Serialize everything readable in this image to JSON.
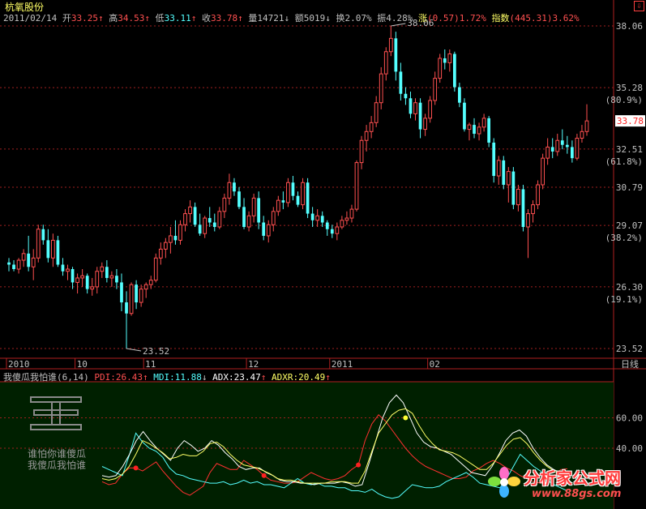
{
  "stock": {
    "name": "杭氧股份",
    "corner_icon": "close-box-icon"
  },
  "quote": {
    "date": "2011/02/14",
    "open_label": "开",
    "open": "33.25",
    "high_label": "高",
    "high": "34.53",
    "low_label": "低",
    "low": "33.11",
    "close_label": "收",
    "close": "33.78",
    "vol_label": "量",
    "vol": "14721",
    "amt_label": "额",
    "amt": "5019",
    "turn_label": "换",
    "turn": "2.07%",
    "amp_label": "振",
    "amp": "4.28%",
    "chg_label": "涨",
    "chg": "(0.57)",
    "chg_pct": "1.72%",
    "idx_label": "指数",
    "idx": "(445.31)",
    "idx_pct": "3.62%"
  },
  "price_axis": [
    {
      "v": 38.06,
      "label": "38.06",
      "pct": ""
    },
    {
      "v": 35.28,
      "label": "35.28",
      "pct": "(80.9%)"
    },
    {
      "v": 32.51,
      "label": "32.51",
      "pct": "(61.8%)"
    },
    {
      "v": 30.79,
      "label": "30.79",
      "pct": ""
    },
    {
      "v": 29.07,
      "label": "29.07",
      "pct": "(38.2%)"
    },
    {
      "v": 26.3,
      "label": "26.30",
      "pct": "(19.1%)"
    },
    {
      "v": 23.52,
      "label": "23.52",
      "pct": ""
    }
  ],
  "last_price_tag": "33.78",
  "max_label": "38.06",
  "min_label": "23.52",
  "time_axis": [
    "2010",
    "10",
    "11",
    "12",
    "2011",
    "02"
  ],
  "period_label": "日线",
  "indicator": {
    "name": "我傻瓜我怕谁(6,14)",
    "pdi_label": "PDI:",
    "pdi": "26.43",
    "mdi_label": "MDI:",
    "mdi": "11.88",
    "adx_label": "ADX:",
    "adx": "23.47",
    "adxr_label": "ADXR:",
    "adxr": "20.49",
    "levels": [
      "60.00",
      "40.00"
    ],
    "watermark_line1": "谁怕你谁傻瓜",
    "watermark_line2": "我傻瓜我怕谁"
  },
  "logo": {
    "text": "分析家公式网",
    "url": "www.88gs.com"
  },
  "colors": {
    "up": "#ff5050",
    "down": "#54ffff",
    "pdi": "#ff3030",
    "mdi": "#54ffff",
    "adx": "#ffffff",
    "adxr": "#ffff66",
    "panel_bg": "#002000"
  },
  "chart_data": [
    {
      "type": "candlestick",
      "title": "杭氧股份",
      "ylim": [
        23.52,
        38.06
      ],
      "candles": [
        [
          27.4,
          27.6,
          27.0,
          27.3
        ],
        [
          27.3,
          27.5,
          27.0,
          27.1
        ],
        [
          27.1,
          27.6,
          26.9,
          27.5
        ],
        [
          27.5,
          28.0,
          27.2,
          27.8
        ],
        [
          27.8,
          28.6,
          27.0,
          27.2
        ],
        [
          27.2,
          28.0,
          26.6,
          27.6
        ],
        [
          27.6,
          29.1,
          27.4,
          28.9
        ],
        [
          28.9,
          29.1,
          28.2,
          28.4
        ],
        [
          28.4,
          28.9,
          27.4,
          27.6
        ],
        [
          27.6,
          28.7,
          27.2,
          28.4
        ],
        [
          28.4,
          28.6,
          27.2,
          27.3
        ],
        [
          27.3,
          27.6,
          26.8,
          27.0
        ],
        [
          27.0,
          27.3,
          26.6,
          27.1
        ],
        [
          27.1,
          27.2,
          26.2,
          26.5
        ],
        [
          26.5,
          26.9,
          26.0,
          26.7
        ],
        [
          26.7,
          27.1,
          26.3,
          26.8
        ],
        [
          26.8,
          26.9,
          26.0,
          26.2
        ],
        [
          26.2,
          26.7,
          25.9,
          26.3
        ],
        [
          26.3,
          27.2,
          26.0,
          27.0
        ],
        [
          27.0,
          27.4,
          26.7,
          27.2
        ],
        [
          27.2,
          27.5,
          26.5,
          26.7
        ],
        [
          26.7,
          27.0,
          26.3,
          26.8
        ],
        [
          26.8,
          27.1,
          26.2,
          26.5
        ],
        [
          26.5,
          26.9,
          25.2,
          25.6
        ],
        [
          25.6,
          26.1,
          23.52,
          25.1
        ],
        [
          25.1,
          26.5,
          25.0,
          26.4
        ],
        [
          26.4,
          26.6,
          25.3,
          25.6
        ],
        [
          25.6,
          26.4,
          25.4,
          26.2
        ],
        [
          26.2,
          26.5,
          25.8,
          26.4
        ],
        [
          26.4,
          26.8,
          26.2,
          26.6
        ],
        [
          26.6,
          27.8,
          26.5,
          27.6
        ],
        [
          27.6,
          28.3,
          27.3,
          28.0
        ],
        [
          28.0,
          28.5,
          27.6,
          28.3
        ],
        [
          28.3,
          29.0,
          27.8,
          28.6
        ],
        [
          28.6,
          29.3,
          28.2,
          28.4
        ],
        [
          28.4,
          29.3,
          28.2,
          29.1
        ],
        [
          29.1,
          29.8,
          28.8,
          29.6
        ],
        [
          29.6,
          30.2,
          29.2,
          29.9
        ],
        [
          29.9,
          30.1,
          29.0,
          29.1
        ],
        [
          29.1,
          29.6,
          28.6,
          28.7
        ],
        [
          28.7,
          29.5,
          28.5,
          29.4
        ],
        [
          29.4,
          29.9,
          29.0,
          29.2
        ],
        [
          29.2,
          29.6,
          28.8,
          29.0
        ],
        [
          29.0,
          29.9,
          28.9,
          29.7
        ],
        [
          29.7,
          30.5,
          29.4,
          30.3
        ],
        [
          30.3,
          31.4,
          30.0,
          31.0
        ],
        [
          31.0,
          31.2,
          30.4,
          30.6
        ],
        [
          30.6,
          30.8,
          29.8,
          29.9
        ],
        [
          29.9,
          30.3,
          28.9,
          29.0
        ],
        [
          29.0,
          29.7,
          28.8,
          29.5
        ],
        [
          29.5,
          30.5,
          29.2,
          30.3
        ],
        [
          30.3,
          30.6,
          28.9,
          29.2
        ],
        [
          29.2,
          29.5,
          28.4,
          28.6
        ],
        [
          28.6,
          29.3,
          28.3,
          29.1
        ],
        [
          29.1,
          29.9,
          28.8,
          29.7
        ],
        [
          29.7,
          30.4,
          29.5,
          30.2
        ],
        [
          30.2,
          30.6,
          29.8,
          30.1
        ],
        [
          30.1,
          31.2,
          29.9,
          31.0
        ],
        [
          31.0,
          31.3,
          30.2,
          30.4
        ],
        [
          30.4,
          30.6,
          29.9,
          30.0
        ],
        [
          30.0,
          31.2,
          29.8,
          31.0
        ],
        [
          31.0,
          31.2,
          29.4,
          29.6
        ],
        [
          29.6,
          29.9,
          29.0,
          29.3
        ],
        [
          29.3,
          29.8,
          29.0,
          29.5
        ],
        [
          29.5,
          29.7,
          29.0,
          29.2
        ],
        [
          29.2,
          29.3,
          28.6,
          28.9
        ],
        [
          28.9,
          29.1,
          28.5,
          28.7
        ],
        [
          28.7,
          29.2,
          28.4,
          29.0
        ],
        [
          29.0,
          29.5,
          28.9,
          29.3
        ],
        [
          29.3,
          29.7,
          29.1,
          29.4
        ],
        [
          29.4,
          30.0,
          29.2,
          29.8
        ],
        [
          29.8,
          32.0,
          29.7,
          31.9
        ],
        [
          31.9,
          33.1,
          31.6,
          32.9
        ],
        [
          32.9,
          33.6,
          32.4,
          33.3
        ],
        [
          33.3,
          34.0,
          33.0,
          33.7
        ],
        [
          33.7,
          34.9,
          33.5,
          34.6
        ],
        [
          34.6,
          36.2,
          34.3,
          35.9
        ],
        [
          35.9,
          37.1,
          35.6,
          36.9
        ],
        [
          36.9,
          38.06,
          36.7,
          37.5
        ],
        [
          37.5,
          37.8,
          35.6,
          36.0
        ],
        [
          36.0,
          36.4,
          34.7,
          35.0
        ],
        [
          35.0,
          35.3,
          34.5,
          34.8
        ],
        [
          34.8,
          35.1,
          33.9,
          34.1
        ],
        [
          34.1,
          34.8,
          33.8,
          34.6
        ],
        [
          34.6,
          34.8,
          33.0,
          33.4
        ],
        [
          33.4,
          34.1,
          33.1,
          33.9
        ],
        [
          33.9,
          34.9,
          33.7,
          34.7
        ],
        [
          34.7,
          36.0,
          34.5,
          35.7
        ],
        [
          35.7,
          36.8,
          35.5,
          36.6
        ],
        [
          36.6,
          37.0,
          36.1,
          36.4
        ],
        [
          36.4,
          37.0,
          36.0,
          36.8
        ],
        [
          36.8,
          36.9,
          35.1,
          35.3
        ],
        [
          35.3,
          35.5,
          34.4,
          34.6
        ],
        [
          34.6,
          34.8,
          33.3,
          33.4
        ],
        [
          33.4,
          33.7,
          32.9,
          33.6
        ],
        [
          33.6,
          33.9,
          33.0,
          33.2
        ],
        [
          33.2,
          33.7,
          32.9,
          33.5
        ],
        [
          33.5,
          34.1,
          33.3,
          33.9
        ],
        [
          33.9,
          34.0,
          32.6,
          32.8
        ],
        [
          32.8,
          33.0,
          31.0,
          31.3
        ],
        [
          31.3,
          32.2,
          30.9,
          32.0
        ],
        [
          32.0,
          32.2,
          30.7,
          30.9
        ],
        [
          30.9,
          31.7,
          30.1,
          31.5
        ],
        [
          31.5,
          31.7,
          29.8,
          30.0
        ],
        [
          30.0,
          30.9,
          29.7,
          30.7
        ],
        [
          30.7,
          30.9,
          28.8,
          29.0
        ],
        [
          29.0,
          29.8,
          27.6,
          29.6
        ],
        [
          29.6,
          30.2,
          29.2,
          30.0
        ],
        [
          30.0,
          31.1,
          29.8,
          30.9
        ],
        [
          30.9,
          32.3,
          30.7,
          32.1
        ],
        [
          32.1,
          33.0,
          31.8,
          32.6
        ],
        [
          32.6,
          33.0,
          32.1,
          32.4
        ],
        [
          32.4,
          33.2,
          32.2,
          32.9
        ],
        [
          32.9,
          33.4,
          32.5,
          32.7
        ],
        [
          32.7,
          33.1,
          32.3,
          32.6
        ],
        [
          32.6,
          32.9,
          31.9,
          32.1
        ],
        [
          32.1,
          33.2,
          32.0,
          33.0
        ],
        [
          33.0,
          33.6,
          32.8,
          33.3
        ],
        [
          33.3,
          34.53,
          33.11,
          33.78
        ]
      ]
    },
    {
      "type": "line",
      "title": "我傻瓜我怕谁(6,14)",
      "ylim": [
        0,
        80
      ],
      "series": [
        {
          "name": "PDI",
          "values": [
            18,
            16,
            17,
            23,
            27,
            27,
            25,
            28,
            31,
            25,
            20,
            15,
            11,
            9,
            12,
            15,
            24,
            30,
            28,
            26,
            26,
            32,
            29,
            26,
            22,
            19,
            18,
            17,
            17,
            18,
            21,
            24,
            22,
            20,
            19,
            20,
            22,
            26,
            29,
            45,
            56,
            62,
            58,
            52,
            46,
            40,
            35,
            31,
            28,
            26,
            24,
            22,
            20,
            20,
            21,
            25,
            27,
            30,
            32,
            30,
            27,
            25,
            22,
            20,
            18,
            17,
            18,
            22,
            26,
            26.43
          ]
        },
        {
          "name": "MDI",
          "values": [
            28,
            26,
            24,
            22,
            35,
            50,
            44,
            40,
            38,
            34,
            27,
            23,
            22,
            20,
            19,
            18,
            17,
            17,
            18,
            16,
            17,
            19,
            17,
            18,
            16,
            16,
            15,
            14,
            17,
            20,
            17,
            16,
            17,
            15,
            15,
            14,
            14,
            12,
            12,
            11,
            13,
            10,
            8,
            7,
            8,
            12,
            16,
            15,
            14,
            14,
            15,
            18,
            20,
            22,
            24,
            21,
            17,
            16,
            15,
            14,
            20,
            28,
            36,
            32,
            28,
            25,
            19,
            16,
            14,
            11.88
          ]
        },
        {
          "name": "ADX",
          "values": [
            22,
            21,
            22,
            28,
            36,
            45,
            51,
            45,
            40,
            36,
            32,
            40,
            45,
            42,
            38,
            40,
            45,
            42,
            37,
            33,
            28,
            26,
            27,
            27,
            24,
            22,
            19,
            18,
            18,
            17,
            17,
            16,
            17,
            17,
            17,
            18,
            17,
            15,
            16,
            30,
            45,
            60,
            70,
            75,
            70,
            60,
            50,
            44,
            41,
            40,
            38,
            36,
            32,
            28,
            24,
            23,
            22,
            28,
            36,
            45,
            50,
            52,
            48,
            40,
            34,
            29,
            26,
            24,
            23.47
          ]
        },
        {
          "name": "ADXR",
          "values": [
            20,
            19,
            20,
            23,
            28,
            36,
            45,
            43,
            40,
            37,
            33,
            34,
            36,
            35,
            35,
            38,
            43,
            44,
            41,
            36,
            32,
            29,
            28,
            27,
            25,
            23,
            20,
            19,
            19,
            18,
            17,
            17,
            17,
            17,
            18,
            18,
            18,
            17,
            17,
            25,
            38,
            50,
            56,
            62,
            65,
            66,
            63,
            55,
            48,
            43,
            39,
            38,
            37,
            35,
            32,
            29,
            26,
            26,
            30,
            36,
            42,
            46,
            47,
            43,
            37,
            32,
            28,
            25,
            23,
            20.49
          ]
        }
      ]
    }
  ]
}
